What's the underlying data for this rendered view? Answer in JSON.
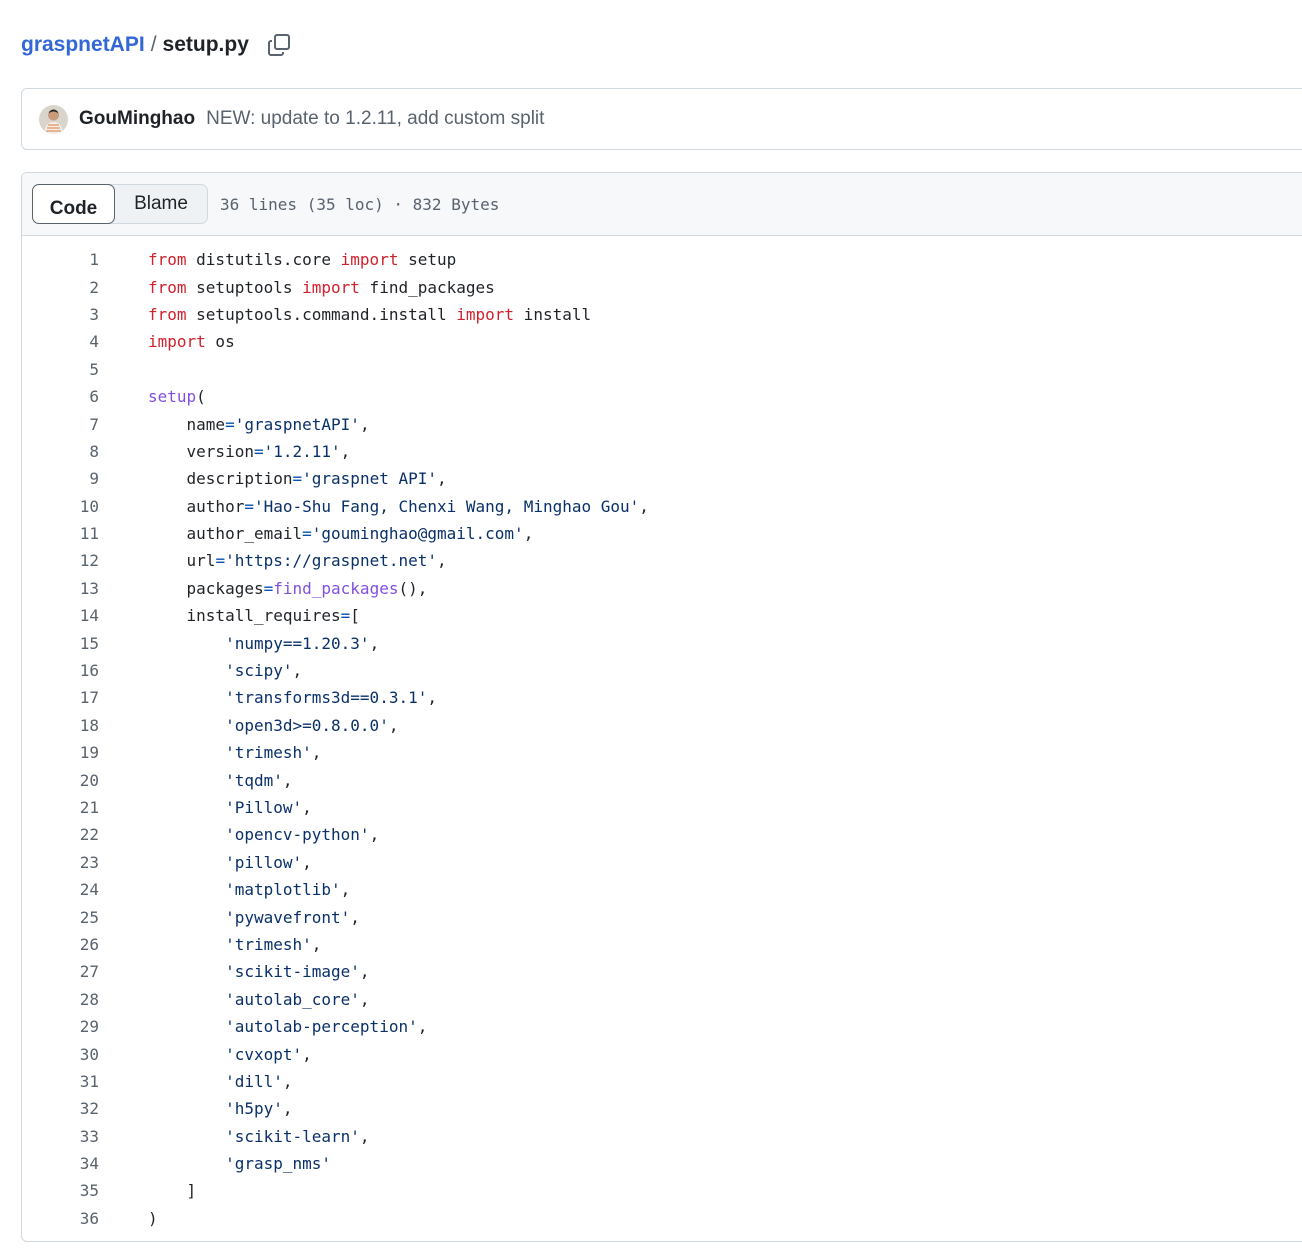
{
  "breadcrumb": {
    "repo": "graspnetAPI",
    "separator": "/",
    "file": "setup.py"
  },
  "commit": {
    "author": "GouMinghao",
    "message": "NEW: update to 1.2.11, add custom split"
  },
  "file_header": {
    "tabs": [
      "Code",
      "Blame"
    ],
    "active_tab": "Code",
    "stats": "36 lines (35 loc) · 832 Bytes"
  },
  "colors": {
    "link": "#3267d6",
    "keyword": "#cf222e",
    "string": "#0a3069",
    "function": "#8250df"
  },
  "code": [
    [
      {
        "t": "from",
        "c": "kw"
      },
      {
        "t": " distutils.core "
      },
      {
        "t": "import",
        "c": "kw"
      },
      {
        "t": " setup"
      }
    ],
    [
      {
        "t": "from",
        "c": "kw"
      },
      {
        "t": " setuptools "
      },
      {
        "t": "import",
        "c": "kw"
      },
      {
        "t": " find_packages"
      }
    ],
    [
      {
        "t": "from",
        "c": "kw"
      },
      {
        "t": " setuptools.command.install "
      },
      {
        "t": "import",
        "c": "kw"
      },
      {
        "t": " install"
      }
    ],
    [
      {
        "t": "import",
        "c": "kw"
      },
      {
        "t": " os"
      }
    ],
    [],
    [
      {
        "t": "setup",
        "c": "fn"
      },
      {
        "t": "("
      }
    ],
    [
      {
        "t": "    name"
      },
      {
        "t": "=",
        "c": "op"
      },
      {
        "t": "'graspnetAPI'",
        "c": "str"
      },
      {
        "t": ","
      }
    ],
    [
      {
        "t": "    version"
      },
      {
        "t": "=",
        "c": "op"
      },
      {
        "t": "'1.2.11'",
        "c": "str"
      },
      {
        "t": ","
      }
    ],
    [
      {
        "t": "    description"
      },
      {
        "t": "=",
        "c": "op"
      },
      {
        "t": "'graspnet API'",
        "c": "str"
      },
      {
        "t": ","
      }
    ],
    [
      {
        "t": "    author"
      },
      {
        "t": "=",
        "c": "op"
      },
      {
        "t": "'Hao-Shu Fang, Chenxi Wang, Minghao Gou'",
        "c": "str"
      },
      {
        "t": ","
      }
    ],
    [
      {
        "t": "    author_email"
      },
      {
        "t": "=",
        "c": "op"
      },
      {
        "t": "'gouminghao@gmail.com'",
        "c": "str"
      },
      {
        "t": ","
      }
    ],
    [
      {
        "t": "    url"
      },
      {
        "t": "=",
        "c": "op"
      },
      {
        "t": "'https://graspnet.net'",
        "c": "str"
      },
      {
        "t": ","
      }
    ],
    [
      {
        "t": "    packages"
      },
      {
        "t": "=",
        "c": "op"
      },
      {
        "t": "find_packages",
        "c": "fn"
      },
      {
        "t": "(),"
      }
    ],
    [
      {
        "t": "    install_requires"
      },
      {
        "t": "=",
        "c": "op"
      },
      {
        "t": "["
      }
    ],
    [
      {
        "t": "        "
      },
      {
        "t": "'numpy==1.20.3'",
        "c": "str"
      },
      {
        "t": ","
      }
    ],
    [
      {
        "t": "        "
      },
      {
        "t": "'scipy'",
        "c": "str"
      },
      {
        "t": ","
      }
    ],
    [
      {
        "t": "        "
      },
      {
        "t": "'transforms3d==0.3.1'",
        "c": "str"
      },
      {
        "t": ","
      }
    ],
    [
      {
        "t": "        "
      },
      {
        "t": "'open3d>=0.8.0.0'",
        "c": "str"
      },
      {
        "t": ","
      }
    ],
    [
      {
        "t": "        "
      },
      {
        "t": "'trimesh'",
        "c": "str"
      },
      {
        "t": ","
      }
    ],
    [
      {
        "t": "        "
      },
      {
        "t": "'tqdm'",
        "c": "str"
      },
      {
        "t": ","
      }
    ],
    [
      {
        "t": "        "
      },
      {
        "t": "'Pillow'",
        "c": "str"
      },
      {
        "t": ","
      }
    ],
    [
      {
        "t": "        "
      },
      {
        "t": "'opencv-python'",
        "c": "str"
      },
      {
        "t": ","
      }
    ],
    [
      {
        "t": "        "
      },
      {
        "t": "'pillow'",
        "c": "str"
      },
      {
        "t": ","
      }
    ],
    [
      {
        "t": "        "
      },
      {
        "t": "'matplotlib'",
        "c": "str"
      },
      {
        "t": ","
      }
    ],
    [
      {
        "t": "        "
      },
      {
        "t": "'pywavefront'",
        "c": "str"
      },
      {
        "t": ","
      }
    ],
    [
      {
        "t": "        "
      },
      {
        "t": "'trimesh'",
        "c": "str"
      },
      {
        "t": ","
      }
    ],
    [
      {
        "t": "        "
      },
      {
        "t": "'scikit-image'",
        "c": "str"
      },
      {
        "t": ","
      }
    ],
    [
      {
        "t": "        "
      },
      {
        "t": "'autolab_core'",
        "c": "str"
      },
      {
        "t": ","
      }
    ],
    [
      {
        "t": "        "
      },
      {
        "t": "'autolab-perception'",
        "c": "str"
      },
      {
        "t": ","
      }
    ],
    [
      {
        "t": "        "
      },
      {
        "t": "'cvxopt'",
        "c": "str"
      },
      {
        "t": ","
      }
    ],
    [
      {
        "t": "        "
      },
      {
        "t": "'dill'",
        "c": "str"
      },
      {
        "t": ","
      }
    ],
    [
      {
        "t": "        "
      },
      {
        "t": "'h5py'",
        "c": "str"
      },
      {
        "t": ","
      }
    ],
    [
      {
        "t": "        "
      },
      {
        "t": "'scikit-learn'",
        "c": "str"
      },
      {
        "t": ","
      }
    ],
    [
      {
        "t": "        "
      },
      {
        "t": "'grasp_nms'",
        "c": "str"
      }
    ],
    [
      {
        "t": "    ]"
      }
    ],
    [
      {
        "t": ")"
      }
    ]
  ]
}
